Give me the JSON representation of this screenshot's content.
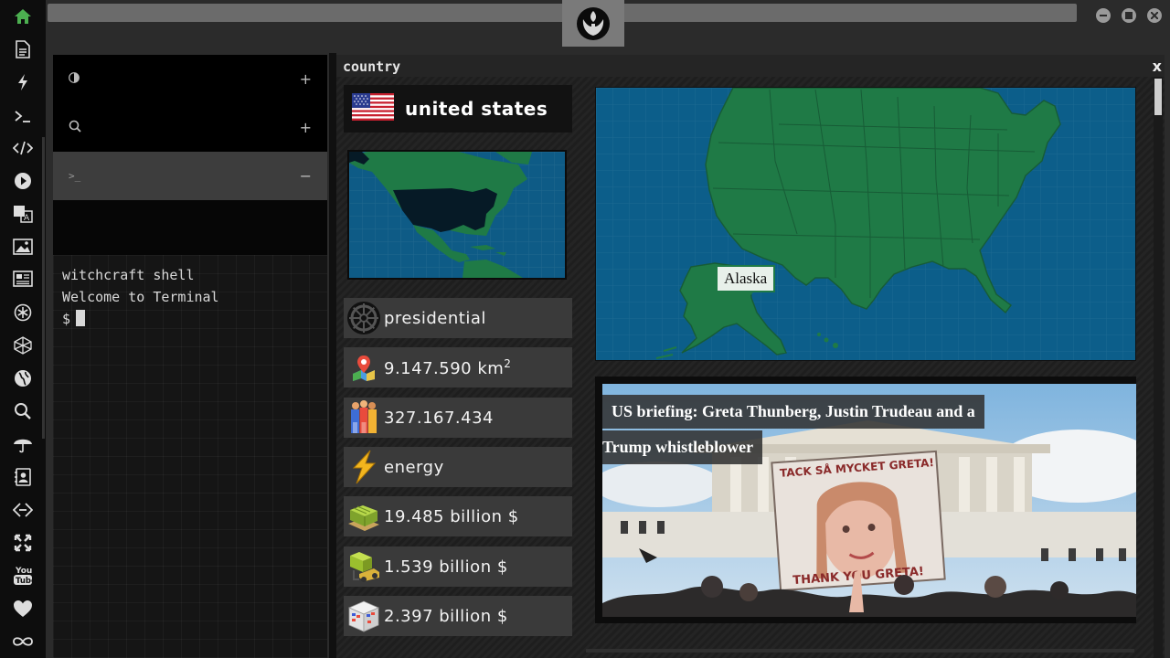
{
  "dock": {
    "icons": [
      "home-icon",
      "document-icon",
      "bolt-icon",
      "terminal-icon",
      "code-icon",
      "play-icon",
      "translate-icon",
      "image-icon",
      "news-icon",
      "asterisk-icon",
      "cube-icon",
      "globe-icon",
      "search-icon",
      "umbrella-icon",
      "contact-icon",
      "link-icon",
      "expand-icon",
      "youtube-icon",
      "heart-icon",
      "infinity-icon"
    ],
    "active_color": "#4caf50",
    "youtube_label": "You Tube"
  },
  "terminal": {
    "rows": [
      {
        "icon": "contrast-icon",
        "action": "+"
      },
      {
        "icon": "search-icon",
        "action": "+"
      },
      {
        "icon": "prompt-icon",
        "glyph": ">_",
        "action": "−"
      }
    ],
    "line1": "witchcraft shell",
    "line2": "Welcome to Terminal",
    "prompt": "$"
  },
  "country": {
    "title": "country",
    "close": "x",
    "name": "united states",
    "government": "presidential",
    "area": "9.147.590 km",
    "area_sup": "2",
    "population": "327.167.434",
    "resource": "energy",
    "gdp": "19.485 billion $",
    "exports": "1.539 billion $",
    "imports": "2.397 billion $",
    "map_tooltip": "Alaska",
    "news_line1": "US briefing: Greta Thunberg, Justin Trudeau and a",
    "news_line2": "Trump whistleblower",
    "sign_top": "TACK SÅ MYCKET GRETA!",
    "sign_bottom": "THANK YOU GRETA!"
  },
  "colors": {
    "land": "#1f7a46",
    "ocean": "#0c5e8a",
    "dark_land": "#061a26"
  }
}
